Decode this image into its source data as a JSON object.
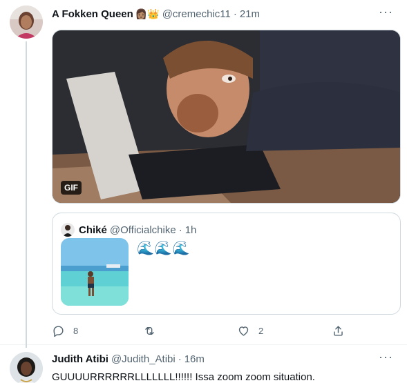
{
  "tweet": {
    "display_name": "A Fokken Queen",
    "emoji": "👩🏽👑",
    "handle": "@cremechic11",
    "separator": "·",
    "time": "21m",
    "more_label": "···",
    "media_badge": "GIF",
    "quote": {
      "display_name": "Chiké",
      "handle": "@Officialchike",
      "separator": "·",
      "time": "1h",
      "text": "🌊🌊🌊"
    },
    "actions": {
      "reply_count": "8",
      "retweet_count": "",
      "like_count": "2"
    }
  },
  "reply": {
    "display_name": "Judith Atibi",
    "handle": "@Judith_Atibi",
    "separator": "·",
    "time": "16m",
    "more_label": "···",
    "text": "GUUUURRRRRRLLLLLLL!!!!!! Issa zoom zoom situation."
  },
  "colors": {
    "accent": "#1d9bf0",
    "secondary_text": "#536471",
    "border": "#cfd9de"
  }
}
